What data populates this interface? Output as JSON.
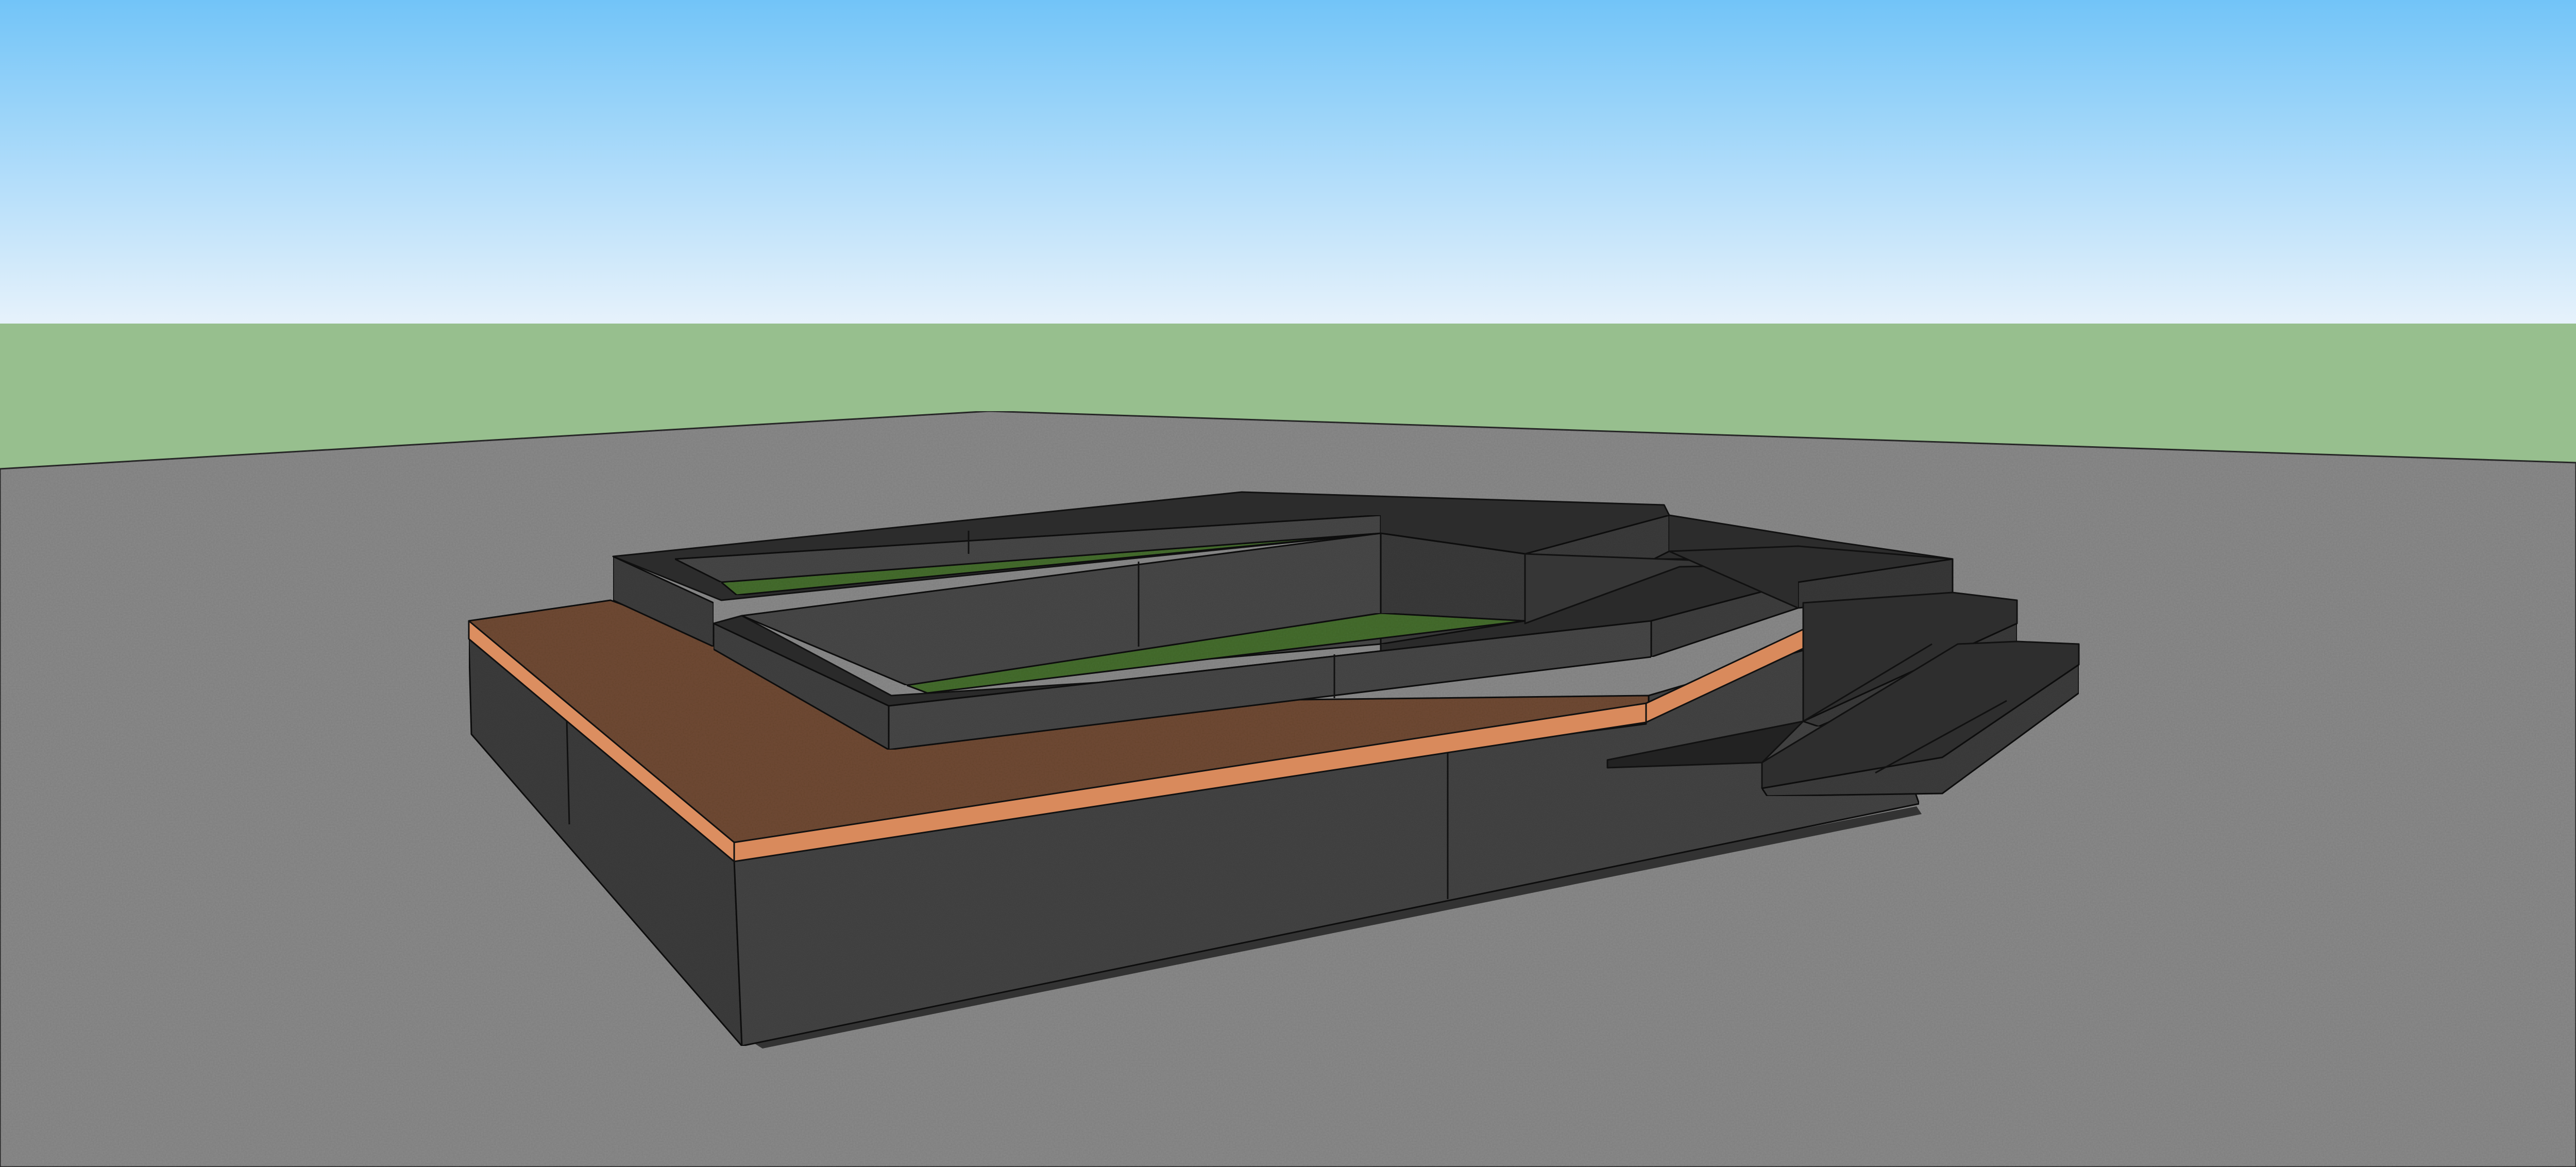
{
  "scene": {
    "subject": "3d-model-raised-planter-with-steps",
    "colors": {
      "sky_top": "#72c4f8",
      "sky_bottom": "#e6f2fb",
      "horizon_grass": "#97bf8e",
      "ground": "#8a8a8a",
      "stone": "#444444",
      "stone_top": "#2c2c2c",
      "wood_top": "#704a33",
      "wood_edge": "#dc8e60",
      "lawn": "#456d2e",
      "edge_line": "#111111"
    }
  }
}
